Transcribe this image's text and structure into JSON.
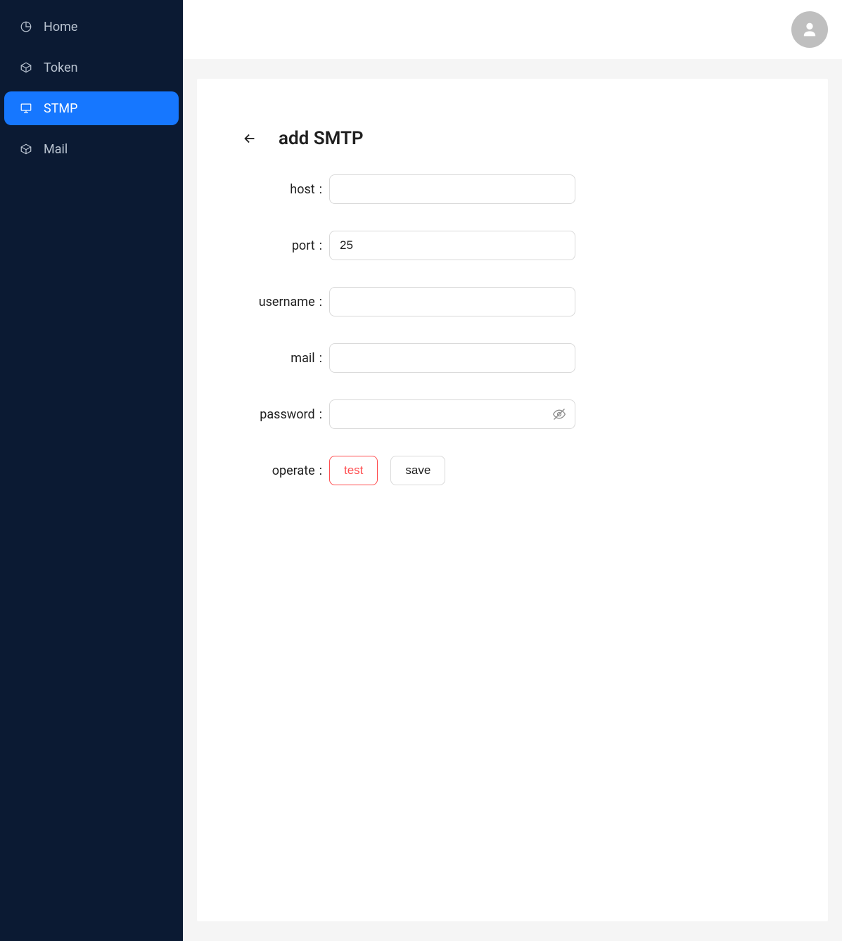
{
  "sidebar": {
    "items": [
      {
        "label": "Home",
        "icon": "pie-chart-icon",
        "active": false
      },
      {
        "label": "Token",
        "icon": "package-icon",
        "active": false
      },
      {
        "label": "STMP",
        "icon": "monitor-icon",
        "active": true
      },
      {
        "label": "Mail",
        "icon": "package-icon",
        "active": false
      }
    ]
  },
  "header": {
    "user_icon": "avatar-icon"
  },
  "page": {
    "title": "add SMTP",
    "back_icon": "arrow-left-icon"
  },
  "form": {
    "host": {
      "label": "host",
      "value": ""
    },
    "port": {
      "label": "port",
      "value": "25"
    },
    "username": {
      "label": "username",
      "value": ""
    },
    "mail": {
      "label": "mail",
      "value": ""
    },
    "password": {
      "label": "password",
      "value": "",
      "toggle_icon": "eye-off-icon"
    },
    "operate": {
      "label": "operate",
      "test_button": "test",
      "save_button": "save"
    }
  },
  "colors": {
    "sidebar_bg": "#0b1a33",
    "active": "#1677ff",
    "danger": "#ff4d4f"
  }
}
